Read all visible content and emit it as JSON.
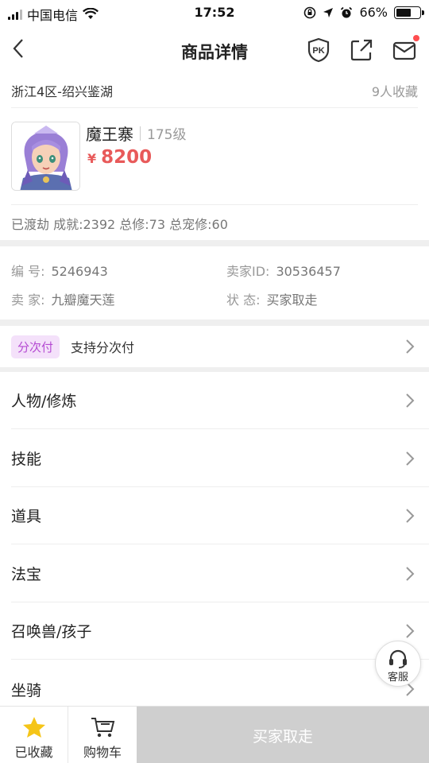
{
  "status_bar": {
    "carrier": "中国电信",
    "time": "17:52",
    "battery": "66%",
    "battery_level": 0.66
  },
  "nav": {
    "title": "商品详情",
    "pk_label": "PK"
  },
  "item": {
    "server": "浙江4区-绍兴鉴湖",
    "favorites": "9人收藏",
    "name": "魔王寨",
    "level": "175级",
    "currency": "¥",
    "price": "8200",
    "achievements": "已渡劫 成就:2392 总修:73 总宠修:60"
  },
  "details": {
    "id_label": "编 号:",
    "id_value": "5246943",
    "seller_id_label": "卖家ID:",
    "seller_id_value": "30536457",
    "seller_label": "卖 家:",
    "seller_value": "九瓣魔天莲",
    "status_label": "状 态:",
    "status_value": "买家取走"
  },
  "installment": {
    "badge": "分次付",
    "text": "支持分次付"
  },
  "menu": [
    {
      "label": "人物/修炼"
    },
    {
      "label": "技能"
    },
    {
      "label": "道具"
    },
    {
      "label": "法宝"
    },
    {
      "label": "召唤兽/孩子"
    },
    {
      "label": "坐骑"
    }
  ],
  "customer_service": {
    "label": "客服"
  },
  "bottom_bar": {
    "fav_label": "已收藏",
    "cart_label": "购物车",
    "action_label": "买家取走"
  },
  "colors": {
    "price": "#e85a5a",
    "badge_bg": "#f4e1fa",
    "badge_text": "#b44ad2",
    "star": "#f5c518",
    "action_disabled": "#cfcfcf"
  },
  "icons": [
    "signal-icon",
    "wifi-icon",
    "lock-rotation-icon",
    "location-icon",
    "alarm-icon",
    "battery-icon",
    "back-icon",
    "pk-icon",
    "share-icon",
    "mail-icon",
    "chevron-right-icon",
    "headset-icon",
    "star-icon",
    "cart-icon"
  ]
}
